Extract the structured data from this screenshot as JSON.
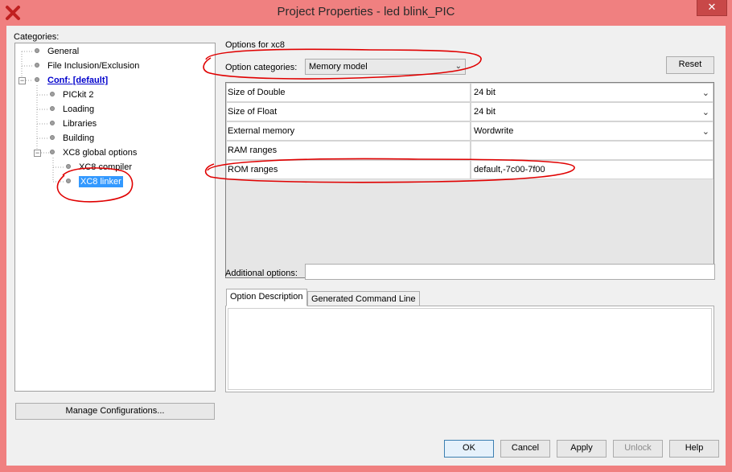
{
  "window": {
    "title": "Project Properties - led blink_PIC",
    "close_label": "✕"
  },
  "categories": {
    "label": "Categories:",
    "items": [
      {
        "label": "General"
      },
      {
        "label": "File Inclusion/Exclusion"
      },
      {
        "label": "Conf: [default]"
      },
      {
        "label": "PICkit 2"
      },
      {
        "label": "Loading"
      },
      {
        "label": "Libraries"
      },
      {
        "label": "Building"
      },
      {
        "label": "XC8 global options"
      },
      {
        "label": "XC8 compiler"
      },
      {
        "label": "XC8 linker"
      }
    ],
    "manage_label": "Manage Configurations..."
  },
  "options": {
    "title": "Options for xc8",
    "category_label": "Option categories:",
    "category_value": "Memory model",
    "reset_label": "Reset",
    "rows": [
      {
        "name": "Size of Double",
        "value": "24 bit"
      },
      {
        "name": "Size of Float",
        "value": "24 bit"
      },
      {
        "name": "External memory",
        "value": "Wordwrite"
      },
      {
        "name": "RAM ranges",
        "value": ""
      },
      {
        "name": "ROM ranges",
        "value": "default,-7c00-7f00"
      }
    ],
    "additional_label": "Additional options:",
    "additional_value": "",
    "tabs": [
      {
        "label": "Option Description"
      },
      {
        "label": "Generated Command Line"
      }
    ]
  },
  "buttons": {
    "ok": "OK",
    "cancel": "Cancel",
    "apply": "Apply",
    "unlock": "Unlock",
    "help": "Help"
  },
  "colors": {
    "titlebar": "#f08080",
    "close": "#c84848",
    "selection": "#3399ff",
    "annotation": "#e00000"
  }
}
